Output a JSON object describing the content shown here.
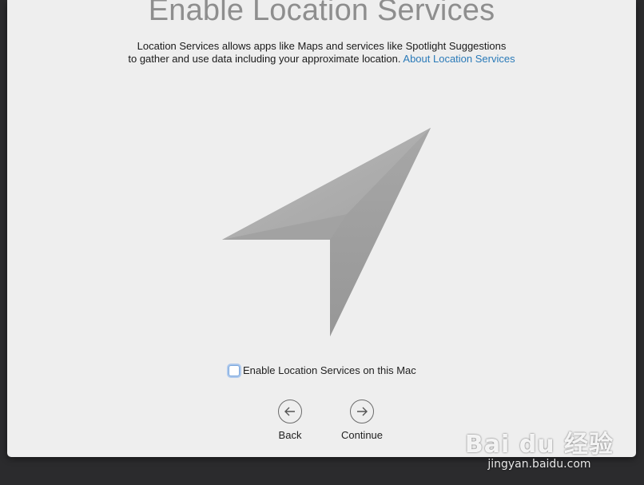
{
  "page": {
    "title": "Enable Location Services",
    "description_line1": "Location Services allows apps like Maps and services like Spotlight Suggestions",
    "description_line2": "to gather and use data including your approximate location.",
    "about_link": "About Location Services"
  },
  "icons": {
    "hero": "location-arrow-icon",
    "back": "arrow-left-circle-icon",
    "continue": "arrow-right-circle-icon"
  },
  "checkbox": {
    "label": "Enable Location Services on this Mac",
    "checked": false
  },
  "nav": {
    "back_label": "Back",
    "continue_label": "Continue"
  },
  "watermark": {
    "logo_text": "Bai du 经验",
    "site": "jingyan.baidu.com"
  },
  "colors": {
    "link": "#2a7ab8",
    "title": "#8e8e8e",
    "window_bg": "#eeeeee"
  }
}
